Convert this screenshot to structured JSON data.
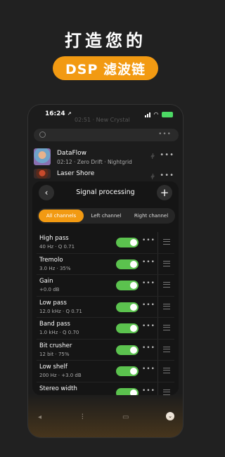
{
  "promo": {
    "headline": "打造您的",
    "pill": "DSP 滤波链"
  },
  "status_bar": {
    "time": "16:24",
    "location_glyph": "↗"
  },
  "header": {
    "faded_title": "02:51 · New Crystal"
  },
  "search": {
    "more_glyph": "•••"
  },
  "tracks": [
    {
      "title": "DataFlow",
      "subtitle": "02:12 · Zero Drift · Nightgrid",
      "more": "•••",
      "eq": "⫩"
    },
    {
      "title": "Laser Shore",
      "subtitle": "",
      "more": "•••",
      "eq": "⫩"
    }
  ],
  "panel": {
    "back_glyph": "‹",
    "title": "Signal processing",
    "add_glyph": "+",
    "tabs": [
      {
        "label": "All channels",
        "active": true
      },
      {
        "label": "Left channel",
        "active": false
      },
      {
        "label": "Right channel",
        "active": false
      }
    ],
    "effects": [
      {
        "name": "High pass",
        "detail": "40 Hz · Q 0.71",
        "enabled": true
      },
      {
        "name": "Tremolo",
        "detail": "3.0 Hz · 35%",
        "enabled": true
      },
      {
        "name": "Gain",
        "detail": "+0.0 dB",
        "enabled": true
      },
      {
        "name": "Low pass",
        "detail": "12.0 kHz · Q 0.71",
        "enabled": true
      },
      {
        "name": "Band pass",
        "detail": "1.0 kHz · Q 0.70",
        "enabled": true
      },
      {
        "name": "Bit crusher",
        "detail": "12 bit · 75%",
        "enabled": true
      },
      {
        "name": "Low shelf",
        "detail": "200 Hz · +3.0 dB",
        "enabled": true
      },
      {
        "name": "Stereo width",
        "detail": "140%",
        "enabled": true
      }
    ],
    "row_more": "•••"
  },
  "bottom_bar": {
    "volume_glyph": "◂",
    "mixer_glyph": "⫶",
    "lyrics_glyph": "▭",
    "chevron_glyph": "⌄"
  },
  "colors": {
    "accent": "#f29a12",
    "toggle_on": "#5bc24e",
    "background": "#212121"
  }
}
